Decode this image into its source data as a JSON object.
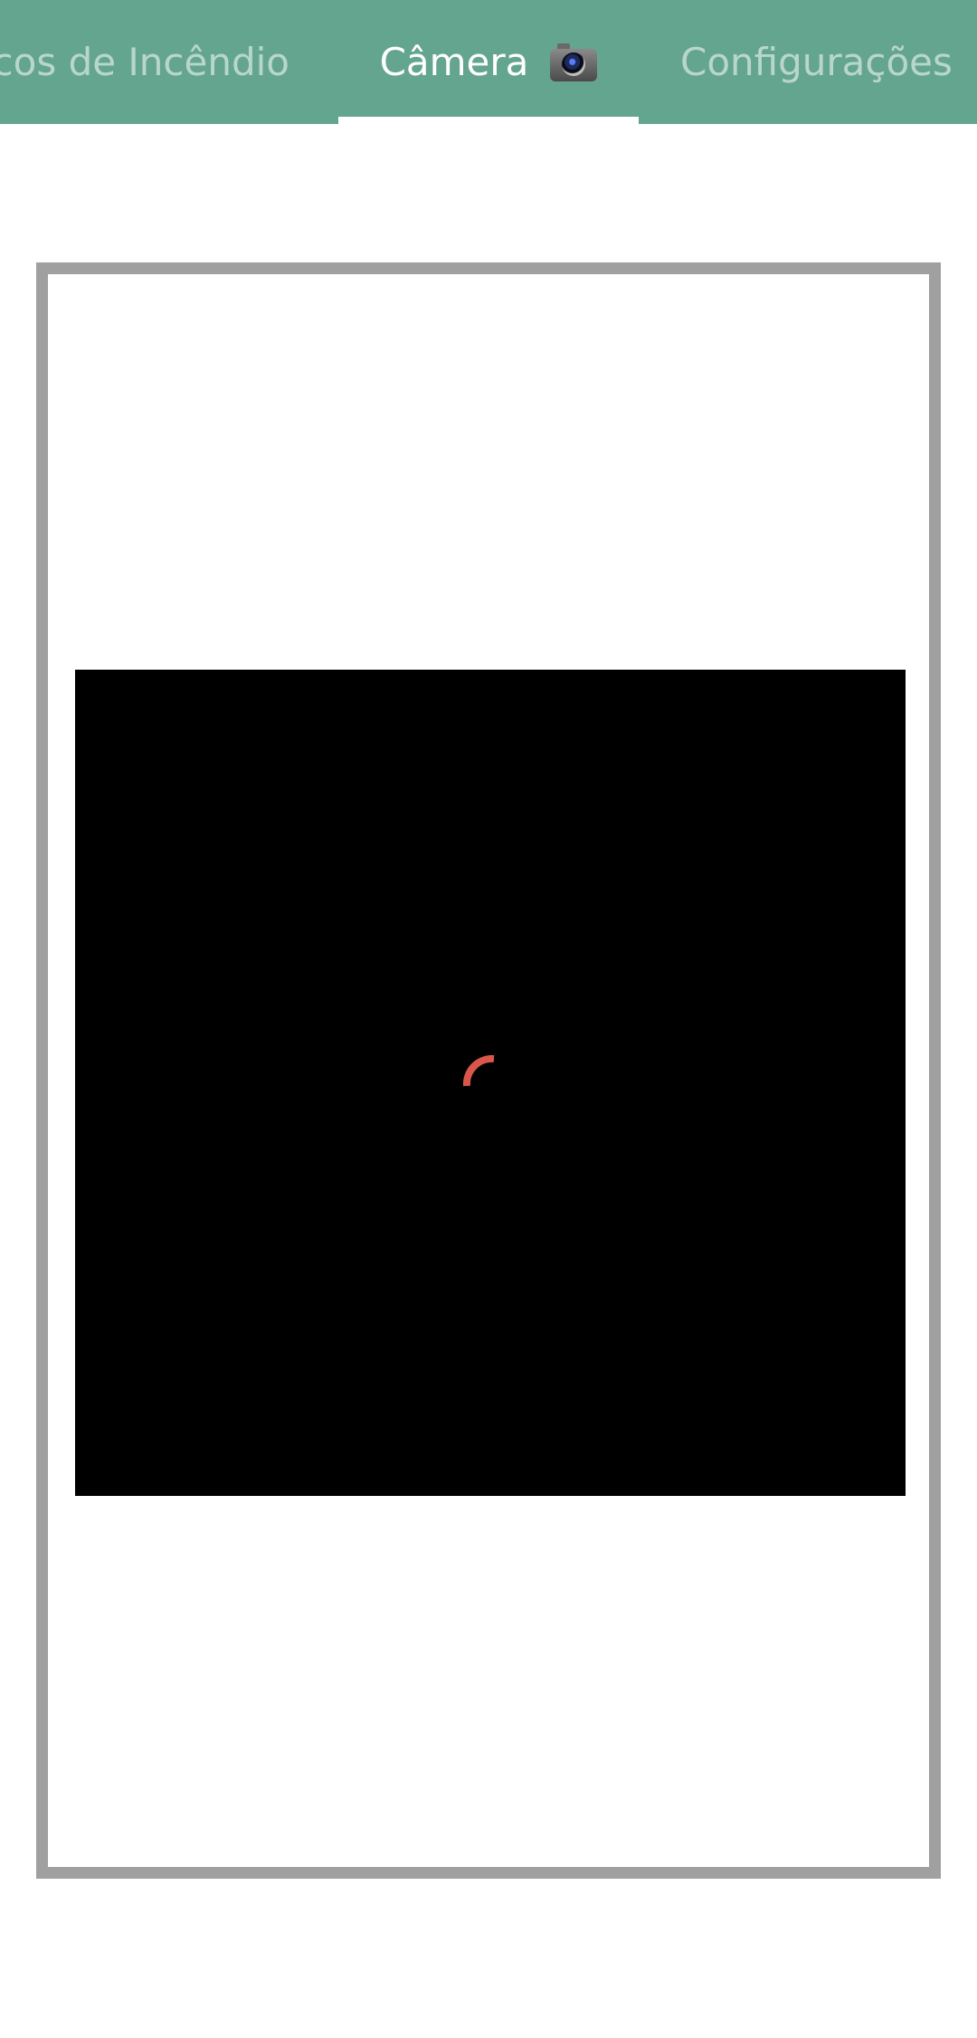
{
  "tabs": [
    {
      "label": "Focos de Incêndio",
      "active": false
    },
    {
      "label": "Câmera",
      "active": true,
      "icon": "camera-icon"
    },
    {
      "label": "Configurações",
      "active": false
    }
  ],
  "colors": {
    "tabbar_bg": "#64a590",
    "frame_border": "#a0a0a0",
    "preview_bg": "#000000",
    "spinner": "#d9574a"
  }
}
